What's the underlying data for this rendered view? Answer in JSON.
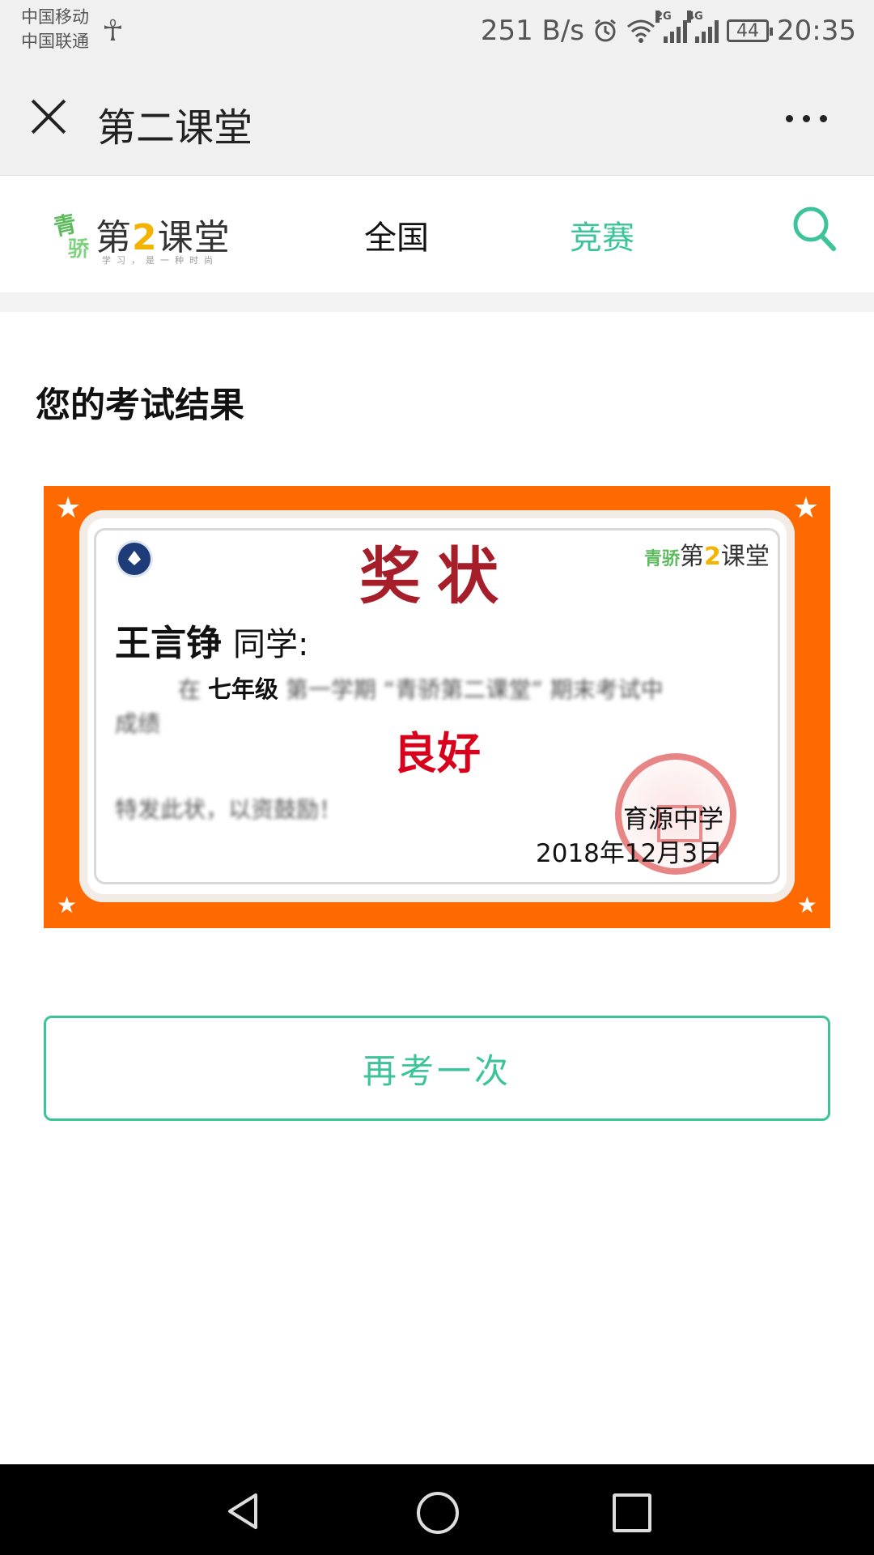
{
  "status_bar": {
    "carrier_1": "中国移动",
    "carrier_2": "中国联通",
    "net_speed": "251 B/s",
    "sim1_tag": "2G",
    "sim2_tag": "4G",
    "battery": "44",
    "time": "20:35"
  },
  "navbar": {
    "title": "第二课堂"
  },
  "site_header": {
    "logo_prefix": "第",
    "logo_two": "2",
    "logo_suffix": "课堂",
    "logo_slogan": "学习，是一种时尚",
    "logo_badge_top": "青",
    "logo_badge_bottom": "骄",
    "nav_quanguo": "全国",
    "nav_jingsai": "竞赛",
    "active_color": "#3cc39a"
  },
  "result": {
    "title": "您的考试结果"
  },
  "certificate": {
    "heading": "奖状",
    "student_name": "王言铮",
    "name_suffix": "同学:",
    "line1_prefix": "在",
    "grade_level": "七年级",
    "line1_rest": "第一学期 “青骄第二课堂” 期末考试中",
    "line2": "成绩",
    "result_grade": "良好",
    "closing": "特发此状，以资鼓励！",
    "school": "育源中学",
    "date": "2018年12月3日",
    "logo_prefix": "第",
    "logo_two": "2",
    "logo_suffix": "课堂",
    "logo_badge": "青骄",
    "border_color": "#ff6a00",
    "heading_color": "#a61e2a",
    "grade_color": "#d8001a"
  },
  "actions": {
    "retry_label": "再考一次"
  }
}
